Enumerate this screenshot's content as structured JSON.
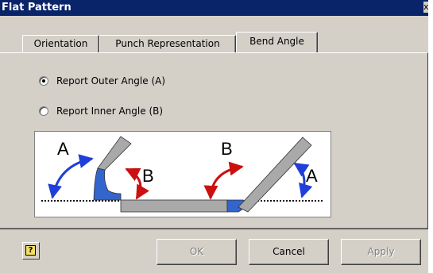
{
  "window": {
    "title": "Flat Pattern",
    "close_glyph": "x"
  },
  "tabs": [
    {
      "label": "Orientation",
      "active": false
    },
    {
      "label": "Punch Representation",
      "active": false
    },
    {
      "label": "Bend Angle",
      "active": true
    }
  ],
  "bend_angle": {
    "options": [
      {
        "label": "Report Outer Angle (A)",
        "selected": true
      },
      {
        "label": "Report Inner Angle (B)",
        "selected": false
      }
    ],
    "diagram": {
      "left_outer_label": "A",
      "left_inner_label": "B",
      "right_inner_label": "B",
      "right_outer_label": "A",
      "colors": {
        "outer_arrow": "#1f3fd8",
        "inner_arrow": "#cc1010",
        "bend": "#3366cc",
        "plate": "#a9a9a9"
      }
    }
  },
  "footer": {
    "help_icon": "help-icon",
    "help_glyph": "?",
    "ok_label": "OK",
    "cancel_label": "Cancel",
    "apply_label": "Apply"
  }
}
